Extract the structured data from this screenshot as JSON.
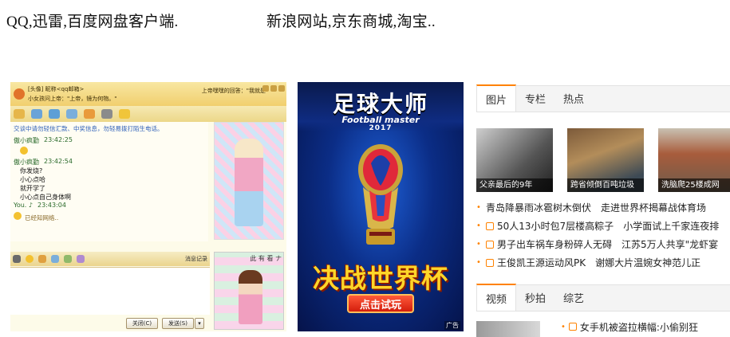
{
  "captions": {
    "left": "QQ,迅雷,百度网盘客户端.",
    "right": "新浪网站,京东商城,淘宝.."
  },
  "qq": {
    "title_line1": "[头像] 昵称<qq邮箱>",
    "title_line2": "小女孩问上帝：\"上帝，镜为何物。\"",
    "title_right": "上帝嘿嘿的回答：\"我就是",
    "notice": "交谈中请勿轻信汇款、中奖信息，勿轻易拨打陌生电话。",
    "messages": [
      {
        "sender": "傲小疯勤",
        "time": "23:42:25",
        "lines": []
      },
      {
        "sender": "傲小疯勤",
        "time": "23:42:54",
        "lines": [
          "你发烧?",
          "小心点哈",
          "就开学了",
          "小心点自己身体啊"
        ]
      },
      {
        "sender": "You. ♪",
        "time": "23:43:04",
        "lines": []
      }
    ],
    "faded_line": "已经知网络..",
    "history_label": "消息记录",
    "close_label": "关闭(C)",
    "send_label": "发送(S)",
    "side_text": "此 有 看 ナ"
  },
  "ad": {
    "title": "足球大师",
    "subtitle": "Football master",
    "year": "2017",
    "slogan": "决战世界杯",
    "cta": "点击试玩",
    "badge": "广告"
  },
  "news": {
    "tabs_top": [
      {
        "label": "图片",
        "active": true
      },
      {
        "label": "专栏",
        "active": false
      },
      {
        "label": "热点",
        "active": false
      }
    ],
    "thumbnails": [
      {
        "caption": "父亲最后的9年"
      },
      {
        "caption": "跨省倾倒百吨垃圾"
      },
      {
        "caption": "洗脑爬25楼成网"
      }
    ],
    "headlines": [
      {
        "a": "青岛降暴雨冰雹树木倒伏",
        "b": "走进世界杯揭幕战体育场",
        "icon": false
      },
      {
        "a": "50人13小时包7层楼高粽子",
        "b": "小学面试上千家连夜排",
        "icon": true
      },
      {
        "a": "男子出车祸车身粉碎人无碍",
        "b": "江苏5万人共享\"龙虾宴",
        "icon": true
      },
      {
        "a": "王俊凯王源运动风PK",
        "b": "谢娜大片温婉女神范儿正",
        "icon": true
      }
    ],
    "tabs_bottom": [
      {
        "label": "视频",
        "active": true
      },
      {
        "label": "秒拍",
        "active": false
      },
      {
        "label": "综艺",
        "active": false
      }
    ],
    "bottom_headline": "女手机被盗拉横幅:小偷别狂"
  }
}
